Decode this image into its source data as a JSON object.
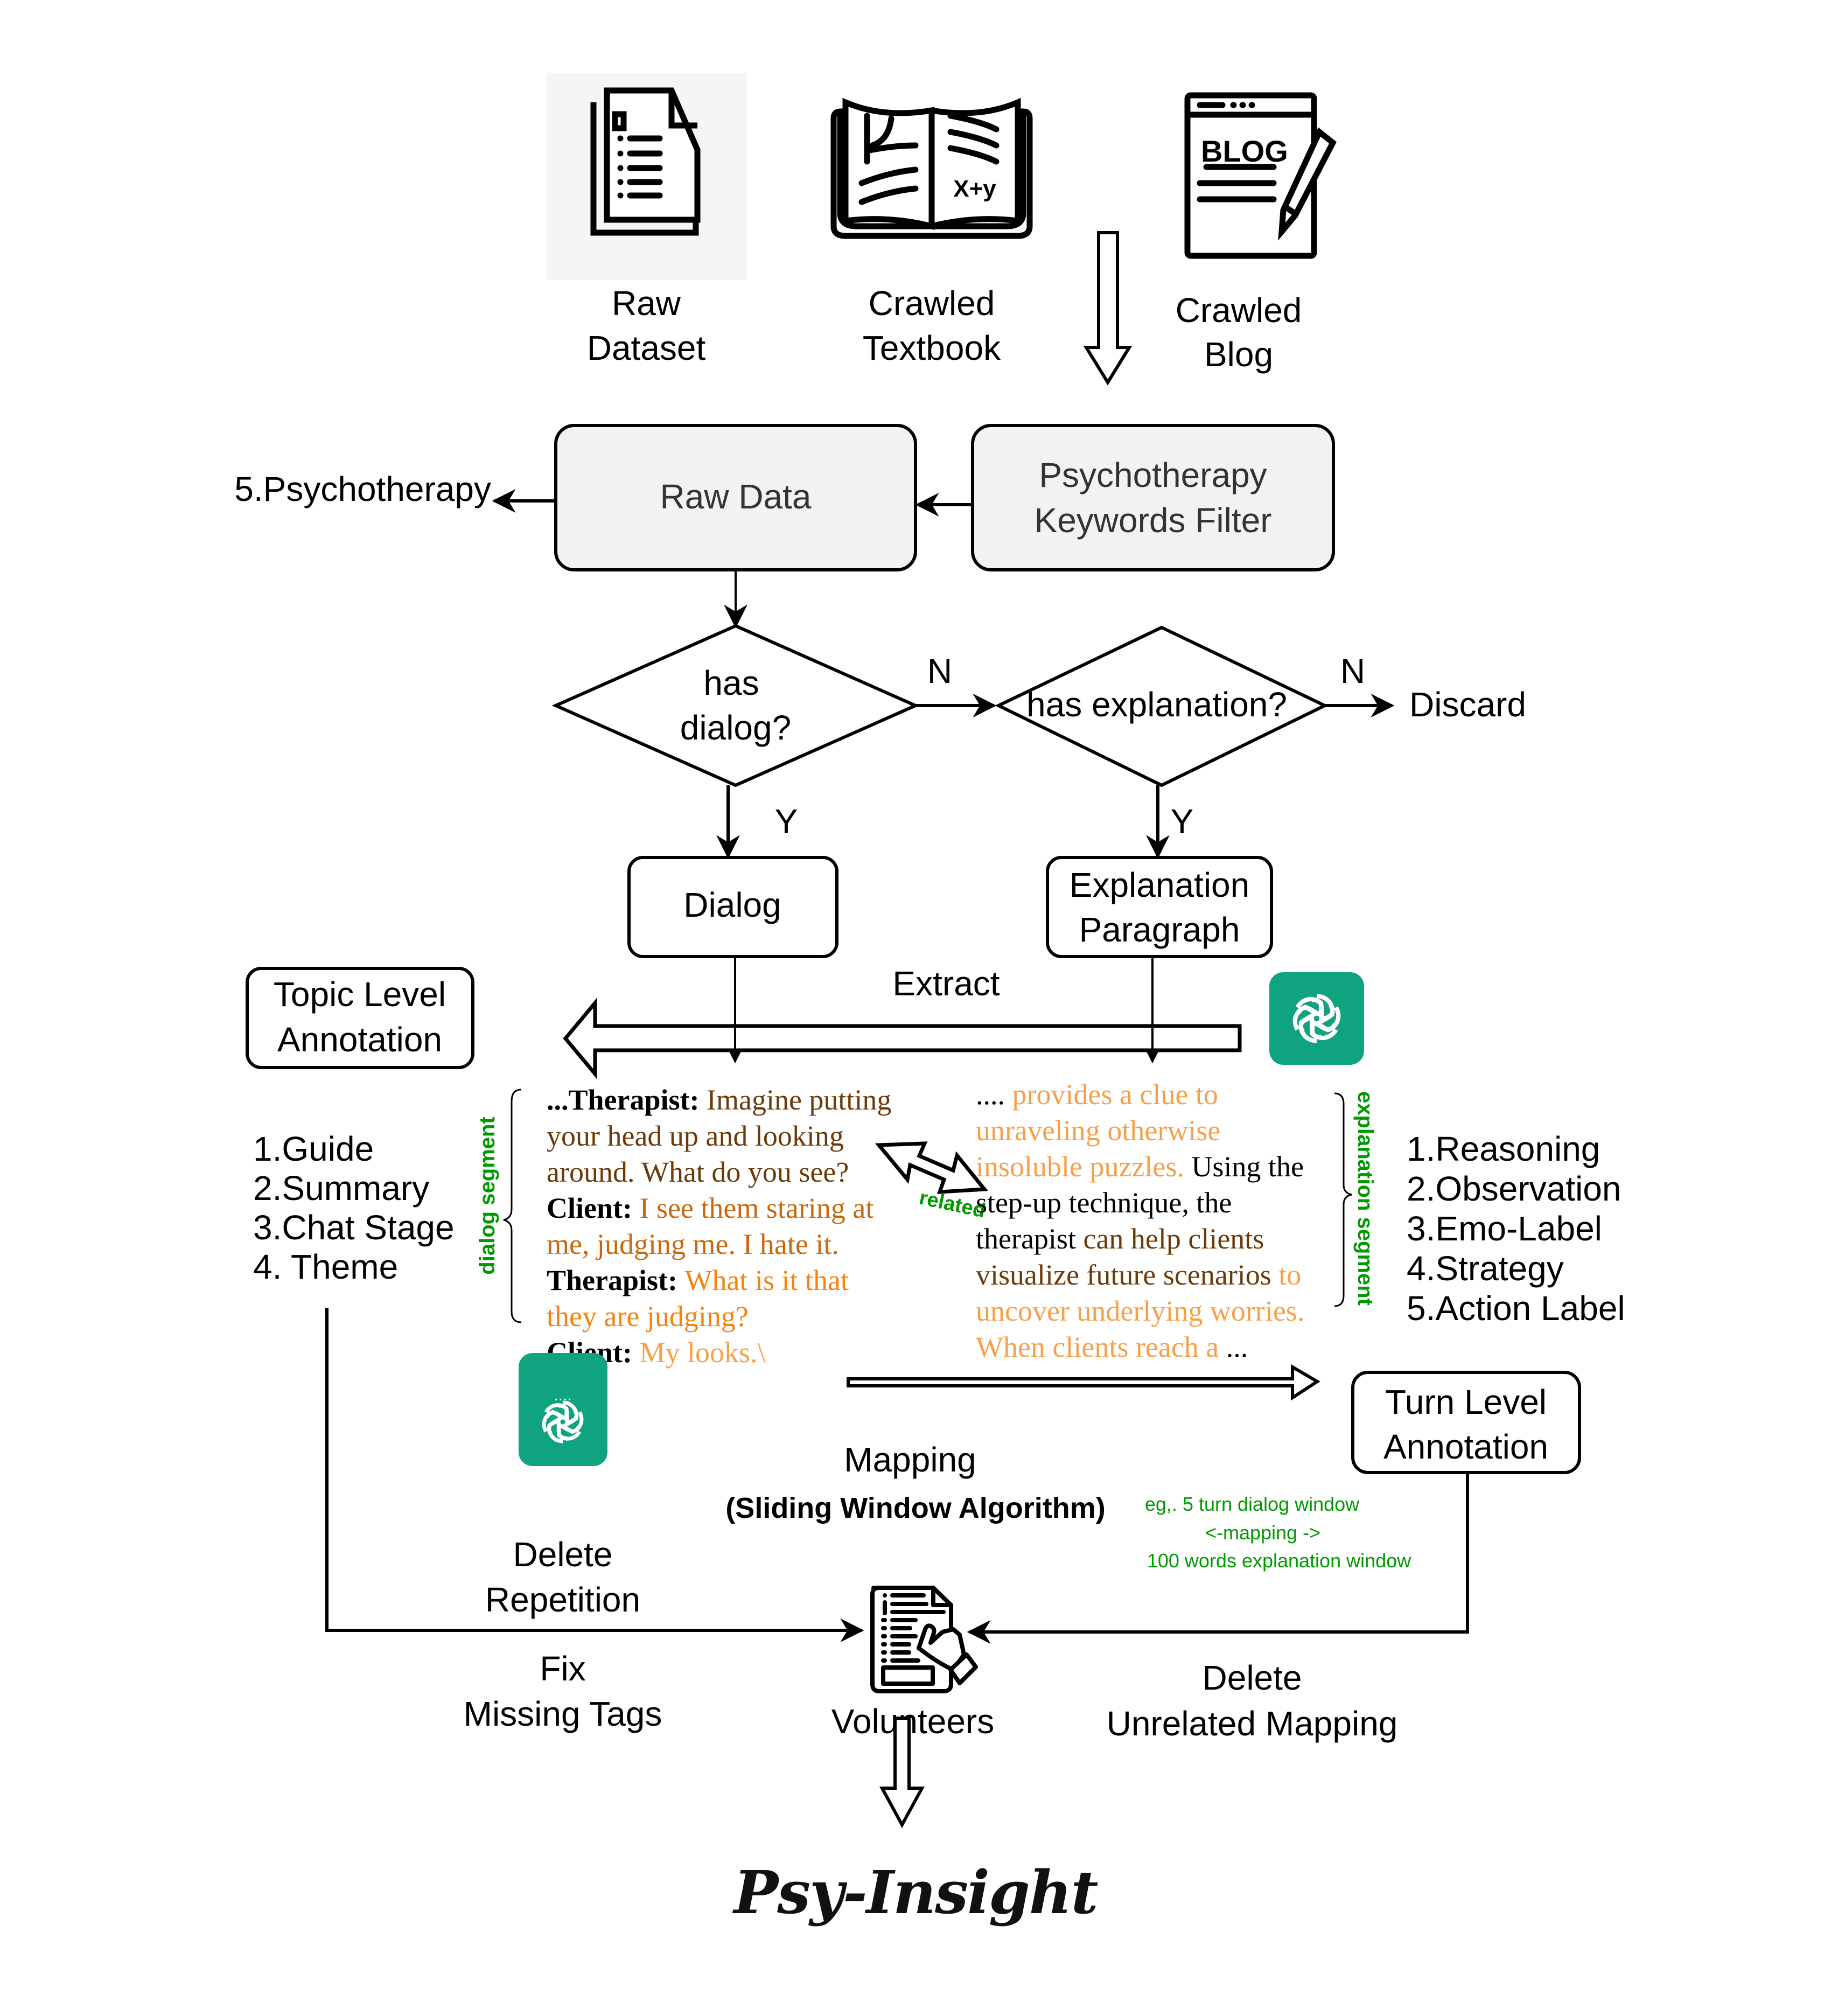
{
  "sources": [
    {
      "icon": "document-stack-icon",
      "line1": "Raw",
      "line2": "Dataset"
    },
    {
      "icon": "open-book-icon",
      "line1": "Crawled",
      "line2": "Textbook"
    },
    {
      "icon": "blog-page-icon",
      "line1": "Crawled",
      "line2": "Blog",
      "icon_text": "BLOG"
    }
  ],
  "book_icon_text": "X+y",
  "raw_data_box": "Raw Data",
  "keywords_filter_box": {
    "line1": "Psychotherapy",
    "line2": "Keywords Filter"
  },
  "psychotherapy_output": "5.Psychotherapy",
  "decision_dialog": {
    "line1": "has",
    "line2": "dialog?"
  },
  "decision_explanation": "has explanation?",
  "edge_labels": {
    "no1": "N",
    "no2": "N",
    "yes1": "Y",
    "yes2": "Y"
  },
  "discard": "Discard",
  "dialog_box": "Dialog",
  "explanation_box": {
    "line1": "Explanation",
    "line2": "Paragraph"
  },
  "extract_label": "Extract",
  "topic_box": {
    "line1": "Topic Level",
    "line2": "Annotation"
  },
  "topic_items": [
    "1.Guide",
    "2.Summary",
    "3.Chat Stage",
    "4. Theme"
  ],
  "dialog_segment_label": "dialog segment",
  "explanation_segment_label": "explanation segment",
  "related_label": "related",
  "dialog_excerpt": [
    [
      {
        "t": "...Therapist: ",
        "s": "speaker"
      },
      {
        "t": "Imagine putting",
        "s": "dark"
      }
    ],
    [
      {
        "t": "your head up and looking",
        "s": "dark"
      }
    ],
    [
      {
        "t": "around. What do you see?",
        "s": "dark"
      }
    ],
    [
      {
        "t": "Client: ",
        "s": "speaker"
      },
      {
        "t": "I see them staring at",
        "s": "mid"
      }
    ],
    [
      {
        "t": "me, judging me. I hate it.",
        "s": "mid"
      }
    ],
    [
      {
        "t": "Therapist: ",
        "s": "speaker"
      },
      {
        "t": "What is it that",
        "s": "bright"
      }
    ],
    [
      {
        "t": "they are judging?",
        "s": "bright"
      }
    ],
    [
      {
        "t": "Client: ",
        "s": "speaker"
      },
      {
        "t": "My looks.\\",
        "s": "light"
      }
    ],
    [
      {
        "t": "....",
        "s": "plain"
      }
    ]
  ],
  "explanation_excerpt": [
    [
      {
        "t": ".... ",
        "s": "plain"
      },
      {
        "t": "provides a clue to",
        "s": "light"
      }
    ],
    [
      {
        "t": "unraveling otherwise",
        "s": "light"
      }
    ],
    [
      {
        "t": "insoluble puzzles. ",
        "s": "light"
      },
      {
        "t": "Using the",
        "s": "plain"
      }
    ],
    [
      {
        "t": "step-up technique, the",
        "s": "plain"
      }
    ],
    [
      {
        "t": "therapist ",
        "s": "plain"
      },
      {
        "t": "can help clients",
        "s": "dark"
      }
    ],
    [
      {
        "t": "visualize future scenarios ",
        "s": "dark"
      },
      {
        "t": "to",
        "s": "light"
      }
    ],
    [
      {
        "t": "uncover underlying worries.",
        "s": "light"
      }
    ],
    [
      {
        "t": "When clients reach a ",
        "s": "light"
      },
      {
        "t": "...",
        "s": "plain"
      }
    ]
  ],
  "turn_items": [
    "1.Reasoning",
    "2.Observation",
    "3.Emo-Label",
    "4.Strategy",
    "5.Action Label"
  ],
  "turn_box": {
    "line1": "Turn Level",
    "line2": "Annotation"
  },
  "mapping_label": "Mapping",
  "mapping_sub": "(Sliding Window Algorithm)",
  "mapping_note": [
    "eg,. 5 turn dialog window",
    "<-mapping ->",
    "100 words explanation window"
  ],
  "delete_repetition": {
    "line1": "Delete",
    "line2": "Repetition"
  },
  "fix_missing": {
    "line1": "Fix",
    "line2": "Missing Tags"
  },
  "delete_unrelated": {
    "line1": "Delete",
    "line2": "Unrelated Mapping"
  },
  "volunteers": "Volunteers",
  "final_output": "Psy-Insight",
  "colors": {
    "gpt_green": "#10a37f",
    "note_green": "#009900",
    "text_dark_brown": "#6b3a0a",
    "text_mid_orange": "#c8690f",
    "text_bright_orange": "#f5840f",
    "text_light_orange": "#f7a04a",
    "box_fill_grey": "#f2f2f2",
    "panel_grey": "#f5f5f5"
  }
}
